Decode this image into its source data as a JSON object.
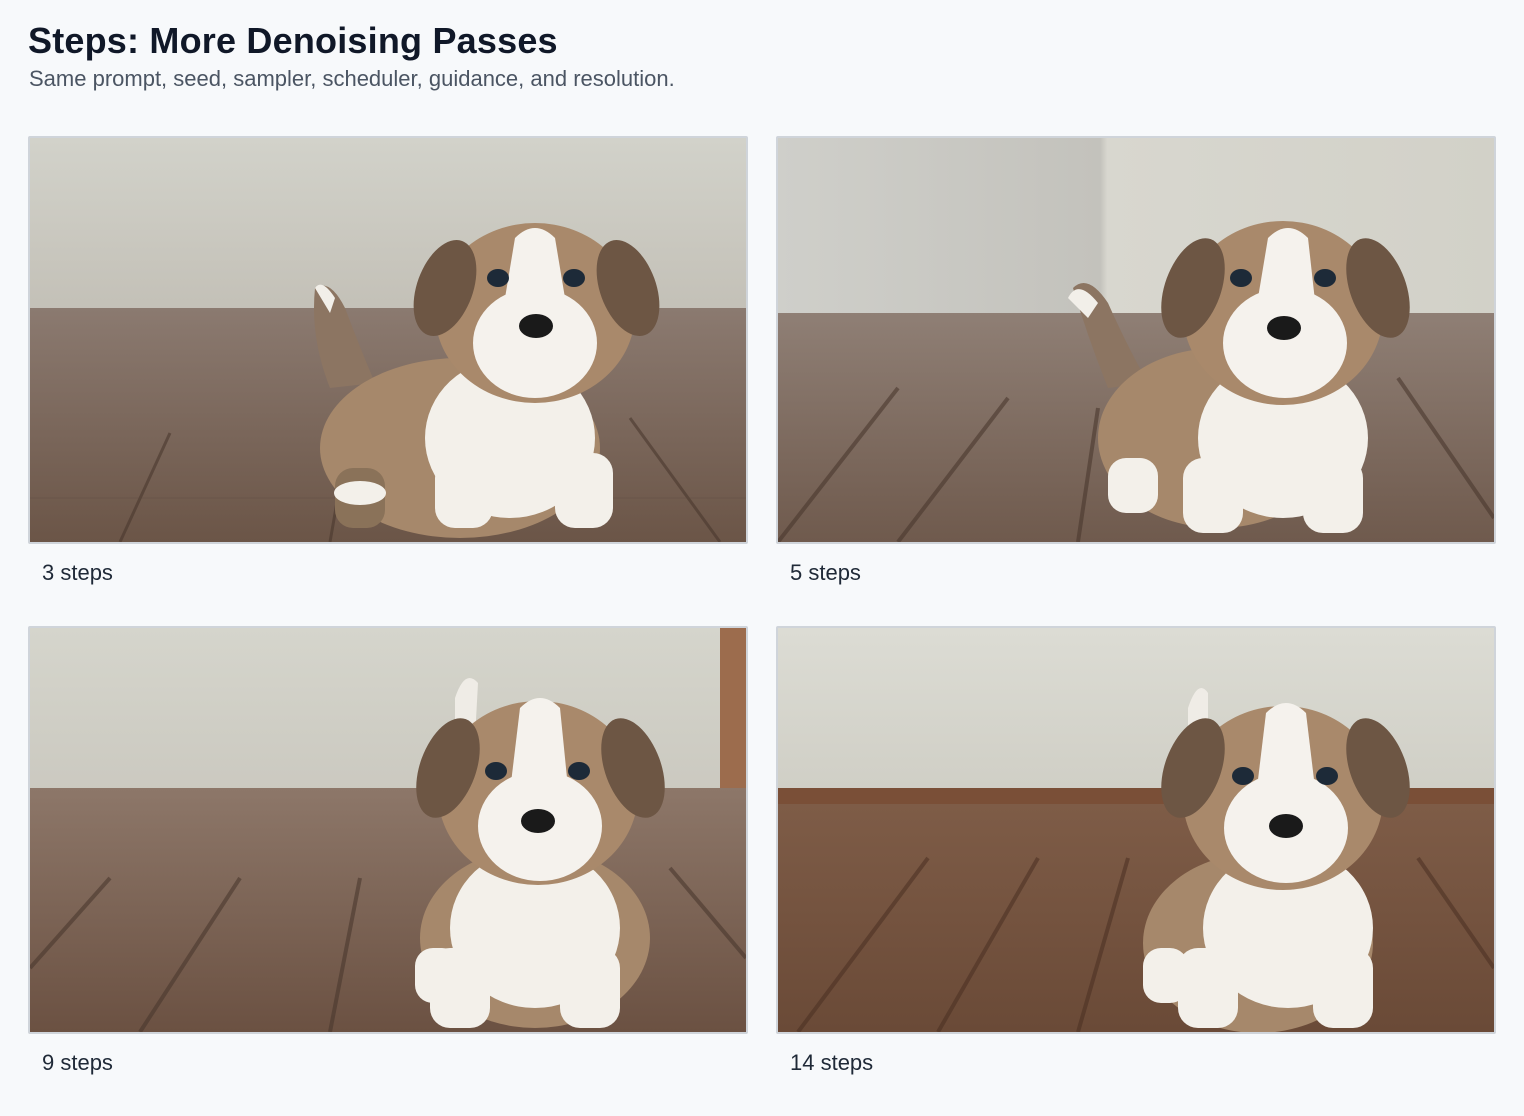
{
  "header": {
    "title": "Steps: More Denoising Passes",
    "subtitle": "Same prompt, seed, sampler, scheduler, guidance, and resolution."
  },
  "panels": [
    {
      "caption": "3 steps"
    },
    {
      "caption": "5 steps"
    },
    {
      "caption": "9 steps"
    },
    {
      "caption": "14 steps"
    }
  ],
  "colors": {
    "background": "#f7f9fb",
    "wall": "#d8d8cf",
    "floor": "#7a6355",
    "fur_brown": "#a9896b",
    "fur_white": "#f4f1ec"
  },
  "icons": [
    "puppy-image"
  ]
}
